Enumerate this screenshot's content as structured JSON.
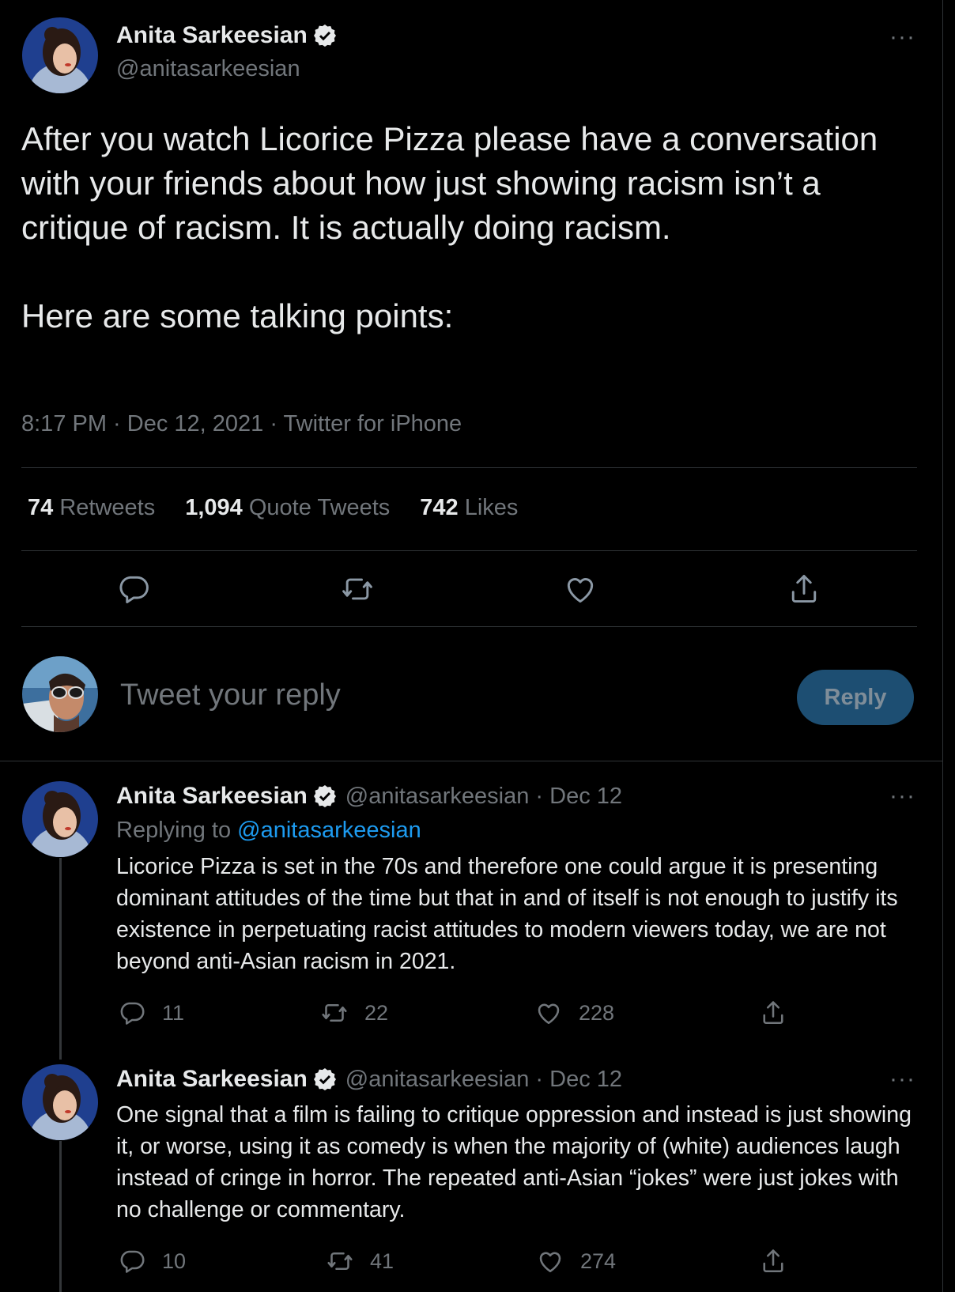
{
  "main_tweet": {
    "author_name": "Anita Sarkeesian",
    "author_handle": "@anitasarkeesian",
    "text_para1": "After you watch Licorice Pizza please have a conversation with your friends about how just showing racism isn’t a critique of racism. It is actually doing racism.",
    "text_para2": "Here are some talking points:",
    "meta": "8:17 PM · Dec 12, 2021 · Twitter for iPhone",
    "stats": {
      "retweets_num": "74",
      "retweets_label": "Retweets",
      "quotes_num": "1,094",
      "quotes_label": "Quote Tweets",
      "likes_num": "742",
      "likes_label": "Likes"
    },
    "more_label": "···"
  },
  "compose": {
    "placeholder": "Tweet your reply",
    "button_label": "Reply"
  },
  "replies": [
    {
      "author_name": "Anita Sarkeesian",
      "handle_date": "@anitasarkeesian · Dec 12",
      "replying_prefix": "Replying to",
      "replying_handle": "@anitasarkeesian",
      "text": "Licorice Pizza is set in the 70s and therefore one could argue it is presenting dominant attitudes of the time but that in and of itself is not enough to justify its existence in perpetuating racist attitudes to modern viewers today, we are not beyond anti-Asian racism in 2021.",
      "reply_count": "11",
      "retweet_count": "22",
      "like_count": "228",
      "more_label": "···"
    },
    {
      "author_name": "Anita Sarkeesian",
      "handle_date": "@anitasarkeesian · Dec 12",
      "text": "One signal that a film is failing to critique oppression and instead is just showing it, or worse, using it as comedy is when the majority of (white) audiences laugh instead of cringe in horror. The repeated anti-Asian “jokes” were just jokes with no challenge or commentary.",
      "reply_count": "10",
      "retweet_count": "41",
      "like_count": "274",
      "more_label": "···"
    }
  ],
  "icons": {
    "verified": "verified-badge-icon",
    "reply": "speech-bubble-icon",
    "retweet": "retweet-icon",
    "like": "heart-icon",
    "share": "share-icon",
    "more": "more-dots-icon"
  },
  "colors": {
    "background": "#000000",
    "text": "#e7e9ea",
    "muted": "#71767b",
    "accent": "#1d9bf0",
    "divider": "#2f3336",
    "reply_button_disabled": "#1d4e72"
  }
}
